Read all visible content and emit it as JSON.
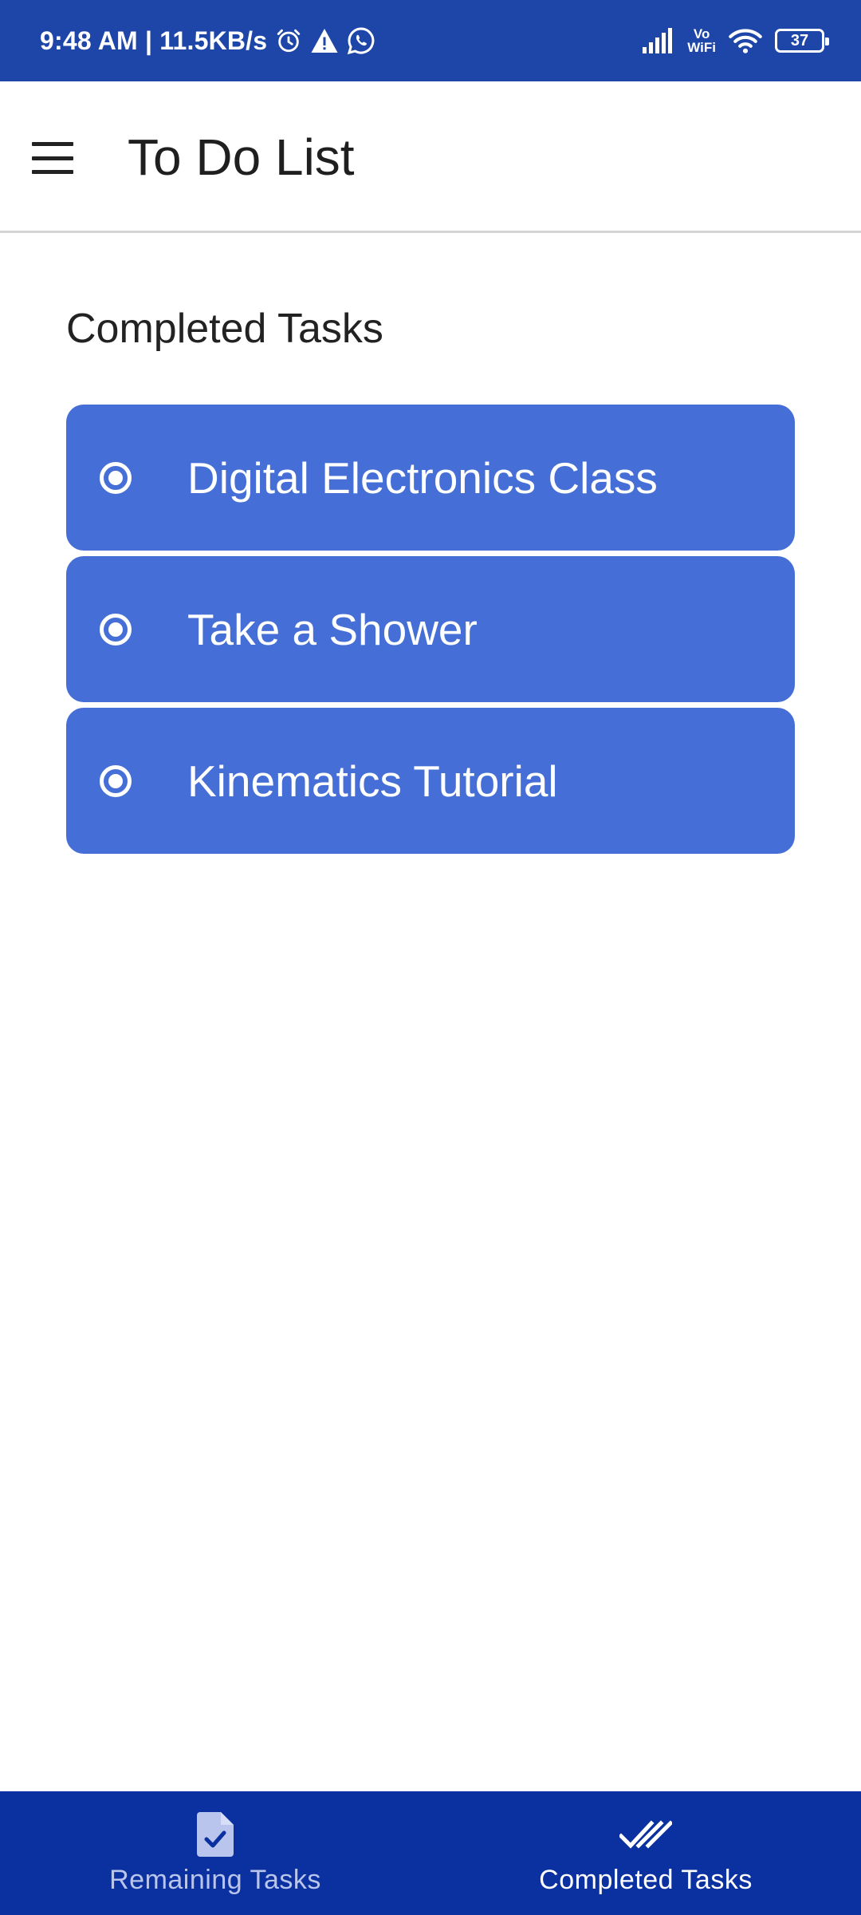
{
  "status_bar": {
    "time_speed": "9:48 AM | 11.5KB/s",
    "vo_wifi_top": "Vo",
    "vo_wifi_bottom": "WiFi",
    "battery": "37",
    "icons": [
      "alarm-icon",
      "warning-icon",
      "whatsapp-icon",
      "signal-icon",
      "wifi-icon",
      "battery-icon"
    ]
  },
  "app_bar": {
    "title": "To Do List",
    "menu_icon": "hamburger-menu-icon"
  },
  "main": {
    "section_title": "Completed Tasks",
    "tasks": [
      {
        "label": "Digital Electronics Class"
      },
      {
        "label": "Take a Shower"
      },
      {
        "label": "Kinematics Tutorial"
      }
    ]
  },
  "bottom_nav": {
    "items": [
      {
        "label": "Remaining Tasks",
        "icon": "task-document-check-icon",
        "active": false
      },
      {
        "label": "Completed Tasks",
        "icon": "double-check-icon",
        "active": true
      }
    ]
  },
  "colors": {
    "status_bar": "#1d46a8",
    "task_card": "#456fd6",
    "bottom_nav": "#0b31a0",
    "text_dark": "#1f1f1f"
  }
}
